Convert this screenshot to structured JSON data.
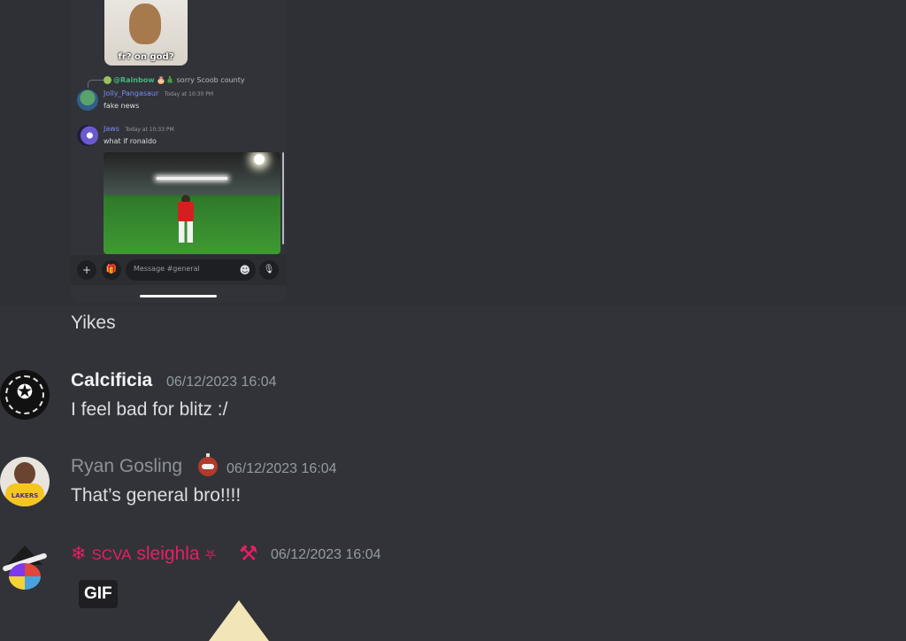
{
  "embedded_screenshot": {
    "image_caption": "fr? on god?",
    "reply": {
      "mention": "@Rainbow",
      "emojis": "🎂🎄",
      "tail": "sorry Scoob county"
    },
    "messages": [
      {
        "author": "Jolly_Pangasaur",
        "time": "Today at 10:30 PM",
        "text": "fake news"
      },
      {
        "author": "Jaws",
        "time": "Today at 10:33 PM",
        "text": "what if ronaldo"
      }
    ],
    "composer": {
      "plus": "+",
      "placeholder": "Message #general",
      "emoji_icon": "☻",
      "mic_icon": "🎙"
    }
  },
  "hovered_message_text": "Yikes",
  "messages": [
    {
      "author": "Calcificia",
      "timestamp": "06/12/2023 16:04",
      "text": "I feel bad for blitz :/",
      "name_color": "#f2f3f5"
    },
    {
      "author": "Ryan Gosling",
      "timestamp": "06/12/2023 16:04",
      "text": "That’s general bro!!!!",
      "name_color": "#8e9297"
    },
    {
      "author": "sleighla",
      "role_tag": "SCVA",
      "prefix_icon": "❄",
      "suffix_icon": "⛧",
      "timestamp": "06/12/2023 16:04",
      "name_color": "#e91e63",
      "attachment_badge": "GIF"
    }
  ],
  "colors": {
    "accent": "#5865f2",
    "background": "#313338",
    "hover": "#2e3035"
  }
}
